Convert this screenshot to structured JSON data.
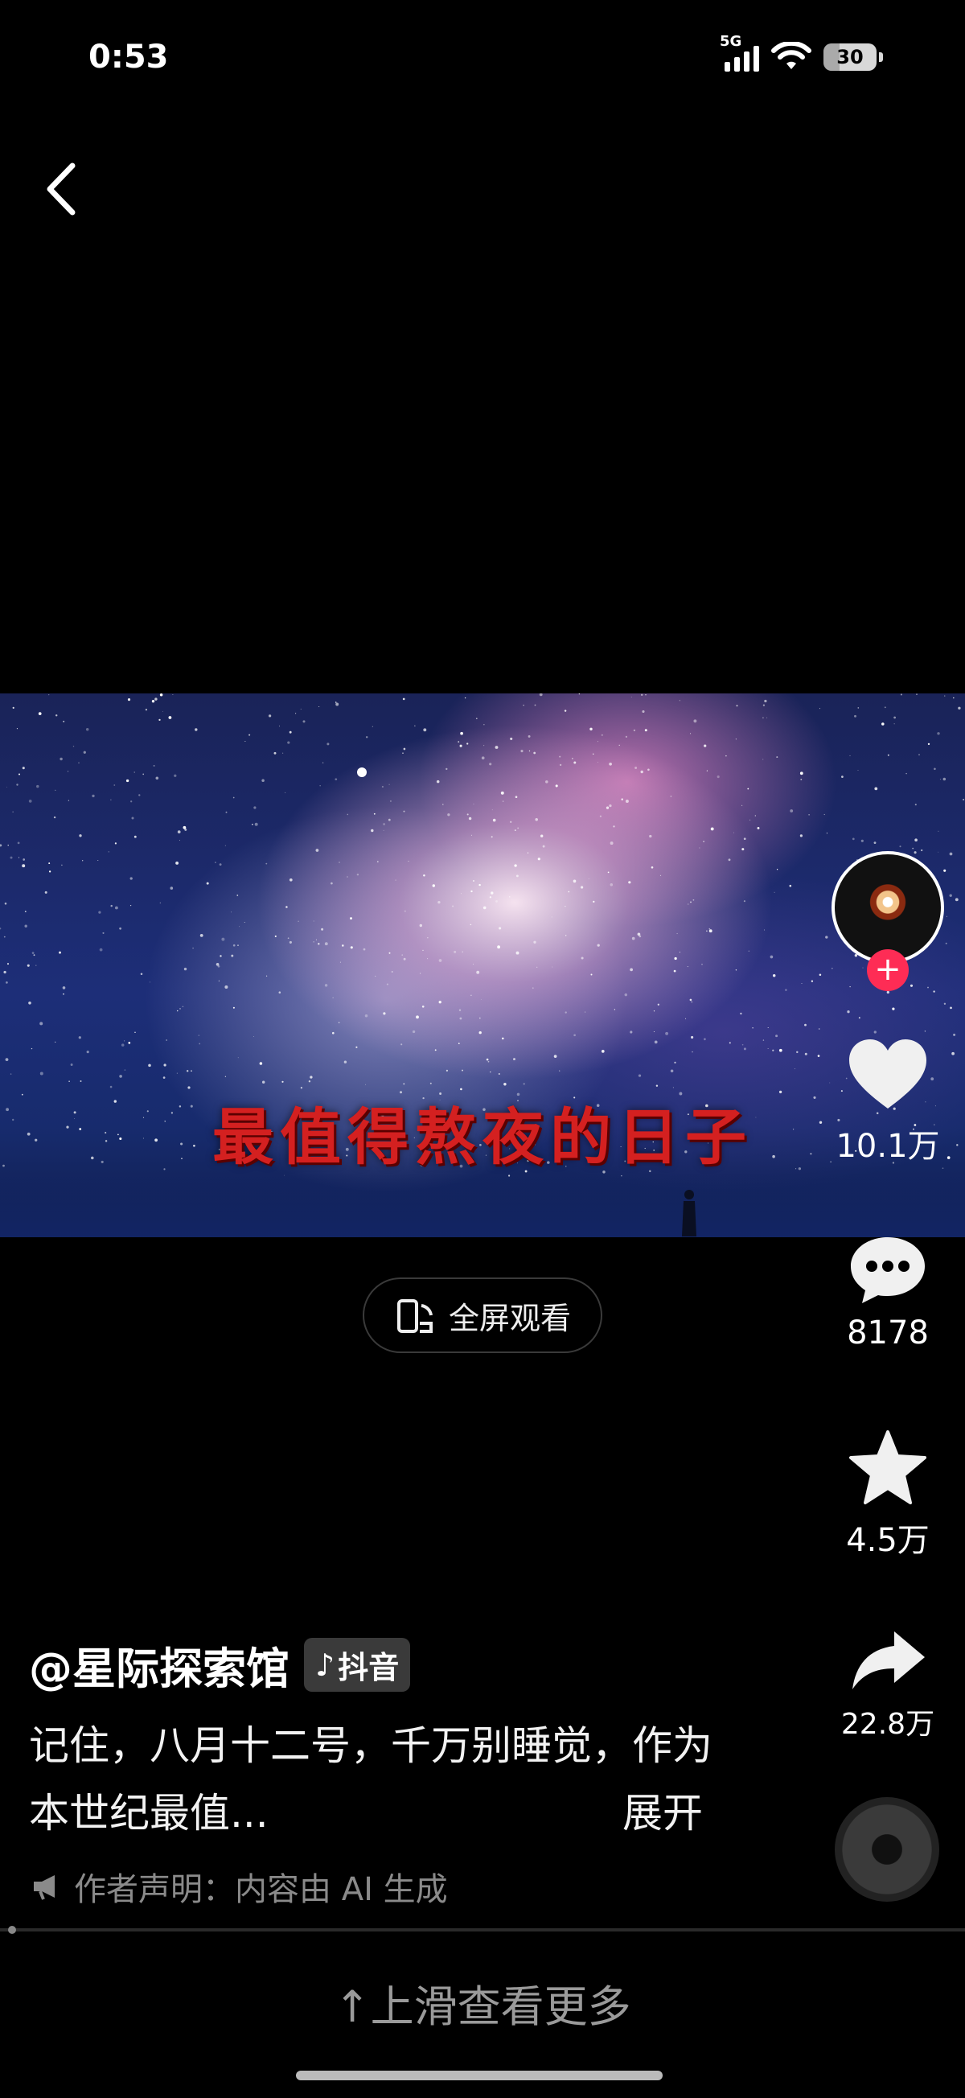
{
  "status_bar": {
    "time": "0:53",
    "network": "5G",
    "battery": "30"
  },
  "nav": {
    "back_icon": "chevron-left-icon"
  },
  "video": {
    "caption": "最值得熬夜的日子"
  },
  "fullscreen": {
    "label": "全屏观看",
    "icon": "rotate-phone-icon"
  },
  "rail": {
    "likes": "10.1万",
    "comments": "8178",
    "favorites": "4.5万",
    "shares": "22.8万"
  },
  "post": {
    "author": "@星际探索馆",
    "badge": "抖音",
    "description": "记住，八月十二号，千万别睡觉，作为本世纪最值...",
    "expand": "展开",
    "declaration": "作者声明：内容由 AI 生成"
  },
  "footer": {
    "swipe_hint": "↑上滑查看更多"
  },
  "colors": {
    "accent_red": "#fe2c55",
    "caption_red": "#d42020"
  }
}
